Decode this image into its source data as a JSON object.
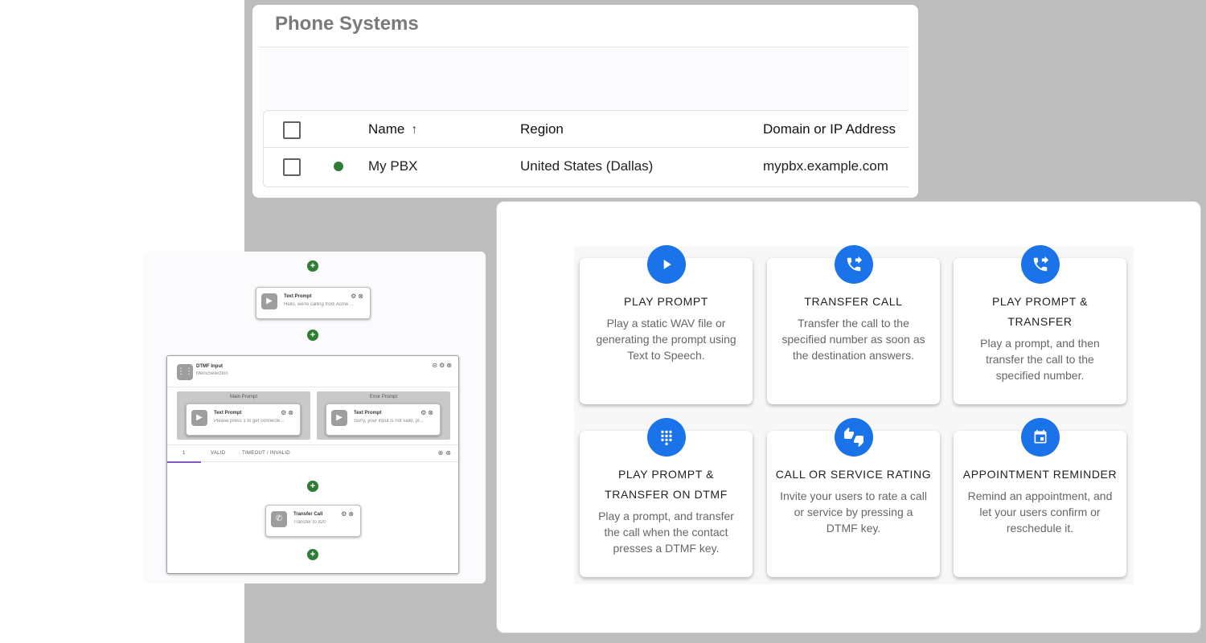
{
  "phone_systems": {
    "title": "Phone Systems",
    "columns": {
      "name": "Name",
      "region": "Region",
      "domain": "Domain or IP Address"
    },
    "rows": [
      {
        "name": "My PBX",
        "region": "United States (Dallas)",
        "domain": "mypbx.example.com",
        "status_color": "#2e7d32"
      }
    ]
  },
  "flow": {
    "text_prompt_node": {
      "title": "Text Prompt",
      "subtitle": "Hello, we're calling from Acme ..."
    },
    "dtmf_node": {
      "title": "DTMF Input",
      "subtitle": "MenuSelection",
      "main_prompt_label": "Main Prompt",
      "error_prompt_label": "Error Prompt",
      "main_prompt": {
        "title": "Text Prompt",
        "subtitle": "Please press 1 to get connecte..."
      },
      "error_prompt": {
        "title": "Text Prompt",
        "subtitle": "Sorry, your input is not valid, pl..."
      },
      "tabs": [
        "1",
        "VALID",
        "TIMEOUT / INVALID"
      ]
    },
    "transfer_node": {
      "title": "Transfer Call",
      "subtitle": "Transfer to 820"
    },
    "add_symbol": "+"
  },
  "templates": [
    {
      "title": "PLAY PROMPT",
      "description": "Play a static WAV file or generating the prompt using Text to Speech.",
      "icon": "play-icon"
    },
    {
      "title": "TRANSFER CALL",
      "description": "Transfer the call to the specified number as soon as the destination answers.",
      "icon": "phone-forward-icon"
    },
    {
      "title": "PLAY PROMPT & TRANSFER",
      "description": "Play a prompt, and then transfer the call to the specified number.",
      "icon": "phone-forward-icon"
    },
    {
      "title": "PLAY PROMPT & TRANSFER ON DTMF",
      "description": "Play a prompt, and transfer the call when the contact presses a DTMF key.",
      "icon": "dialpad-icon"
    },
    {
      "title": "CALL OR SERVICE RATING",
      "description": "Invite your users to rate a call or service by pressing a DTMF key.",
      "icon": "thumbs-up-down-icon"
    },
    {
      "title": "APPOINTMENT REMINDER",
      "description": "Remind an appointment, and let your users confirm or reschedule it.",
      "icon": "calendar-icon"
    }
  ],
  "colors": {
    "accent": "#1a73e8",
    "status_online": "#2e7d32",
    "add_button": "#2e7d32"
  }
}
